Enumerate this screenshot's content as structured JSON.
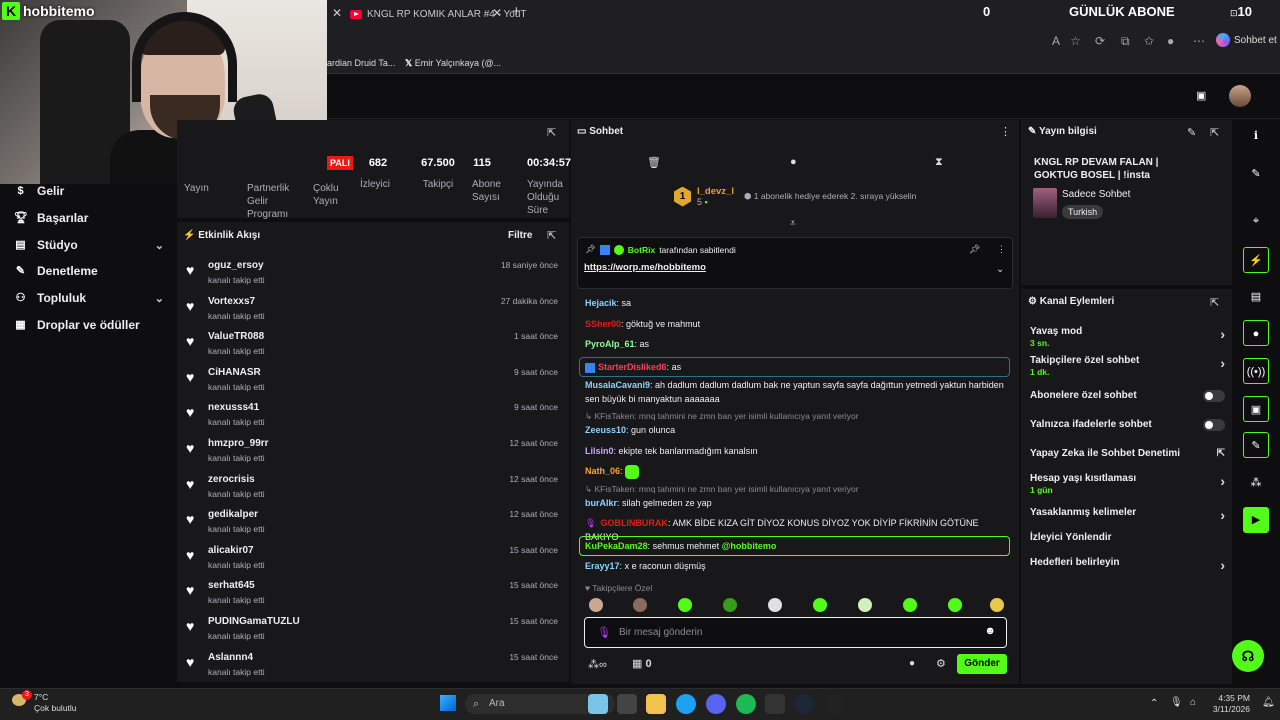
{
  "browser": {
    "tab_title": "KNGL RP KOMIK ANLAR #4 - YouT",
    "overlay_left_count": "0",
    "overlay_title": "GÜNLÜK ABONE",
    "overlay_right_count": "10",
    "sohbet_et": "Sohbet et",
    "bookmarks": [
      "ardian Druid Ta...",
      "Emir Yalçınkaya (@..."
    ]
  },
  "webcam": {
    "logo_text": "hobbitemo"
  },
  "sidebar": {
    "items": [
      {
        "label": "Gelir",
        "icon": "dollar-icon"
      },
      {
        "label": "Başarılar",
        "icon": "trophy-icon"
      },
      {
        "label": "Stüdyo",
        "icon": "film-icon"
      },
      {
        "label": "Denetleme",
        "icon": "wrench-icon"
      },
      {
        "label": "Topluluk",
        "icon": "people-icon"
      },
      {
        "label": "Droplar ve ödüller",
        "icon": "gift-icon"
      }
    ]
  },
  "stats": {
    "pali": "PALI",
    "labels": [
      "Yayın",
      "Partnerlik Gelir Programı",
      "Çoklu Yayın"
    ],
    "values": [
      {
        "value": "682",
        "label": "İzleyici"
      },
      {
        "value": "67.500",
        "label": "Takipçi"
      },
      {
        "value": "115",
        "label": "Abone Sayısı"
      },
      {
        "value": "00:34:57",
        "label": "Yayında Olduğu Süre"
      }
    ]
  },
  "activity": {
    "title": "Etkinlik Akışı",
    "filter": "Filtre",
    "items": [
      {
        "user": "oguz_ersoy",
        "action": "kanalı takip etti",
        "time": "18 saniye önce"
      },
      {
        "user": "Vortexxs7",
        "action": "kanalı takip etti",
        "time": "27 dakika önce"
      },
      {
        "user": "ValueTR088",
        "action": "kanalı takip etti",
        "time": "1 saat önce"
      },
      {
        "user": "CiHANASR",
        "action": "kanalı takip etti",
        "time": "9 saat önce"
      },
      {
        "user": "nexusss41",
        "action": "kanalı takip etti",
        "time": "9 saat önce"
      },
      {
        "user": "hmzpro_99rr",
        "action": "kanalı takip etti",
        "time": "12 saat önce"
      },
      {
        "user": "zerocrisis",
        "action": "kanalı takip etti",
        "time": "12 saat önce"
      },
      {
        "user": "gedikalper",
        "action": "kanalı takip etti",
        "time": "12 saat önce"
      },
      {
        "user": "alicakir07",
        "action": "kanalı takip etti",
        "time": "15 saat önce"
      },
      {
        "user": "serhat645",
        "action": "kanalı takip etti",
        "time": "15 saat önce"
      },
      {
        "user": "PUDINGamaTUZLU",
        "action": "kanalı takip etti",
        "time": "15 saat önce"
      },
      {
        "user": "Aslannn4",
        "action": "kanalı takip etti",
        "time": "15 saat önce"
      }
    ]
  },
  "chat": {
    "title": "Sohbet",
    "gifter": "l_devz_l",
    "gifter_count": "5",
    "gift_text": "1 abonelik hediye ederek 2. sıraya yükselin",
    "gift_rank": "1",
    "pinned_by": "BotRix",
    "pinned_suffix": "tarafından sabitlendi",
    "pinned_link": "https://worp.me/hobbitemo",
    "messages": [
      {
        "user": "Hejacik",
        "color": "#8fd3ff",
        "text": "sa"
      },
      {
        "user": "SSher00",
        "color": "#e91916",
        "text": "göktuğ ve mahmut"
      },
      {
        "user": "PyroAlp_61",
        "color": "#8fff8f",
        "text": "as"
      },
      {
        "user": "StarterDisliked6",
        "color": "#ff3b5c",
        "text": "as"
      },
      {
        "user": "MusalaCavani9",
        "color": "#8fd3ff",
        "text": "ah dadlum dadlum dadlum bak ne yaptun sayfa sayfa dağıttun yetmedi yaktun harbiden sen büyük bi manyaktun aaaaaaa"
      },
      {
        "user": "Zeeuss10",
        "color": "#8fd3ff",
        "text": "gun olunca"
      },
      {
        "user": "Lilsin0",
        "color": "#c9a6ff",
        "text": "ekipte tek banlanmadığım kanalsın"
      },
      {
        "user": "Nath_06",
        "color": "#ff9d3b",
        "text": ""
      },
      {
        "user": "burAlkr",
        "color": "#8fd3ff",
        "text": "silah gelmeden ze yap"
      },
      {
        "user": "GOBLINBURAK",
        "color": "#e91916",
        "text": "AMK BİDE KIZA GİT DİYOZ KONUS DİYOZ YOK DİYİP FİKRİNİN GÖTÜNE BAKIYO"
      },
      {
        "user": "KuPekaDam28",
        "color": "#53fc18",
        "text": "sehmus mehmet",
        "mention": "@hobbitemo"
      },
      {
        "user": "Erayy17",
        "color": "#8fd3ff",
        "text": "x e raconun düşmüş"
      }
    ],
    "reply1": "KFisTaken: mnq tahmini ne zmn ban yer isimli kullanıcıya yanıt veriyor",
    "reply2": "KFisTaken: mnq tahmini ne zmn ban yer isimli kullanıcıya yanıt veriyor",
    "followers_only": "Takipçilere Özel",
    "input_placeholder": "Bir mesaj gönderin",
    "points": "0",
    "send": "Gönder"
  },
  "stream_info": {
    "title": "Yayın bilgisi",
    "stream_title": "KNGL RP DEVAM FALAN | GOKTUG BOSEL | !insta",
    "category": "Sadece Sohbet",
    "language": "Turkish"
  },
  "channel_actions": {
    "title": "Kanal Eylemleri",
    "items": [
      {
        "label": "Yavaş mod",
        "sub": "3 sn.",
        "type": "arrow"
      },
      {
        "label": "Takipçilere özel sohbet",
        "sub": "1 dk.",
        "type": "arrow"
      },
      {
        "label": "Abonelere özel sohbet",
        "sub": "",
        "type": "toggle"
      },
      {
        "label": "Yalnızca ifadelerle sohbet",
        "sub": "",
        "type": "toggle"
      },
      {
        "label": "Yapay Zeka ile Sohbet Denetimi",
        "sub": "",
        "type": "external"
      },
      {
        "label": "Hesap yaşı kısıtlaması",
        "sub": "1 gün",
        "type": "arrow"
      },
      {
        "label": "Yasaklanmış kelimeler",
        "sub": "",
        "type": "arrow"
      },
      {
        "label": "İzleyici Yönlendir",
        "sub": "",
        "type": "none"
      },
      {
        "label": "Hedefleri belirleyin",
        "sub": "",
        "type": "arrow"
      }
    ]
  },
  "taskbar": {
    "temp": "7°C",
    "weather": "Çok bulutlu",
    "weather_badge": "3",
    "search": "Ara",
    "time": "4:35 PM",
    "date": "3/11/2026"
  }
}
